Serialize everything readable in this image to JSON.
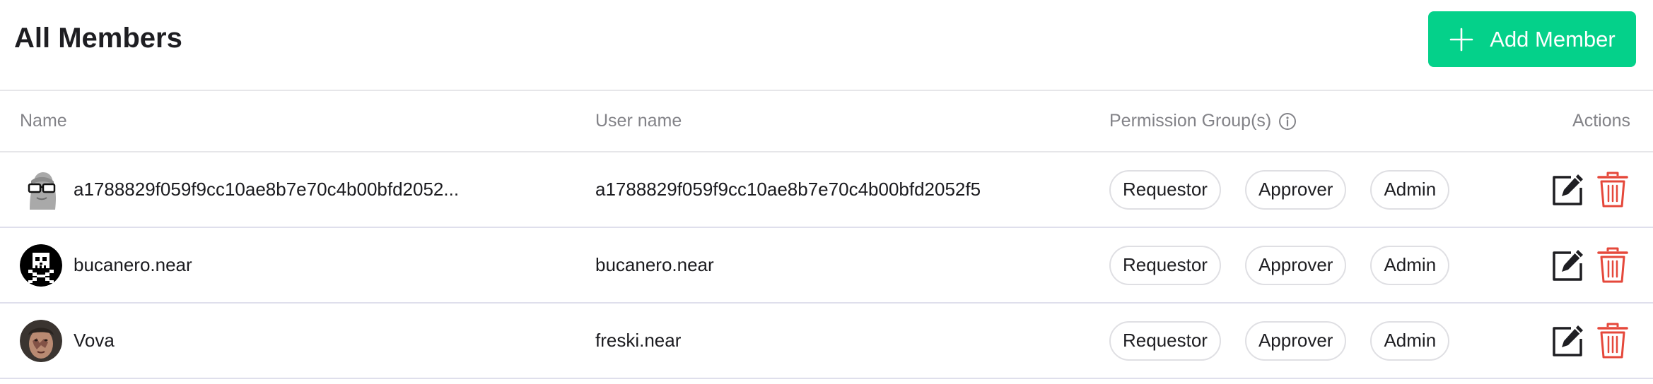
{
  "header": {
    "title": "All Members",
    "add_button_label": "Add Member"
  },
  "table": {
    "columns": {
      "name": "Name",
      "user_name": "User name",
      "permission_groups": "Permission Group(s)",
      "actions": "Actions"
    },
    "rows": [
      {
        "name": "a1788829f059f9cc10ae8b7e70c4b00bfd2052...",
        "user_name": "a1788829f059f9cc10ae8b7e70c4b00bfd2052f5",
        "avatar": "default-avatar-icon",
        "permissions": [
          "Requestor",
          "Approver",
          "Admin"
        ]
      },
      {
        "name": "bucanero.near",
        "user_name": "bucanero.near",
        "avatar": "skull-pixel-avatar",
        "permissions": [
          "Requestor",
          "Approver",
          "Admin"
        ]
      },
      {
        "name": "Vova",
        "user_name": "freski.near",
        "avatar": "photo-avatar",
        "permissions": [
          "Requestor",
          "Approver",
          "Admin"
        ]
      }
    ]
  },
  "icons": {
    "add": "plus-icon",
    "info": "info-icon",
    "edit": "edit-icon",
    "delete": "trash-icon"
  },
  "colors": {
    "accent": "#04d18a",
    "delete": "#e5483b",
    "muted_text": "#838388",
    "border": "#e6e6e9"
  }
}
